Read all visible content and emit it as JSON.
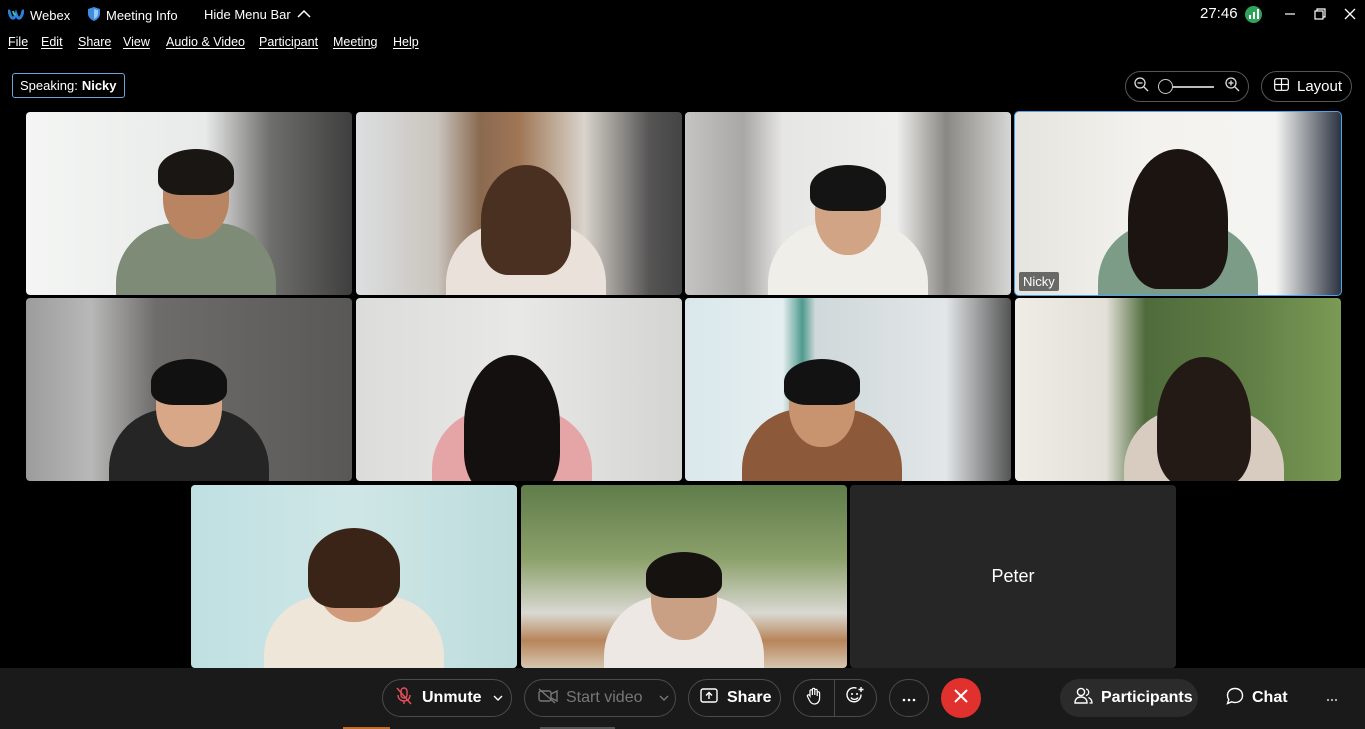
{
  "titlebar": {
    "app_name": "Webex",
    "meeting_info": "Meeting Info",
    "hide_menu": "Hide Menu Bar",
    "time": "27:46"
  },
  "menu": [
    "File",
    "Edit",
    "Share",
    "View",
    "Audio & Video",
    "Participant",
    "Meeting",
    "Help"
  ],
  "speaking": {
    "label": "Speaking:",
    "name": "Nicky"
  },
  "layout_button": "Layout",
  "tiles": [
    {
      "name": "",
      "active": false
    },
    {
      "name": "",
      "active": false
    },
    {
      "name": "",
      "active": false
    },
    {
      "name": "Nicky",
      "active": true
    },
    {
      "name": "",
      "active": false
    },
    {
      "name": "",
      "active": false
    },
    {
      "name": "",
      "active": false
    },
    {
      "name": "",
      "active": false
    },
    {
      "name": "",
      "active": false
    },
    {
      "name": "",
      "active": false
    },
    {
      "name": "Peter",
      "active": false
    }
  ],
  "controls": {
    "unmute": "Unmute",
    "start_video": "Start video",
    "share": "Share",
    "participants": "Participants",
    "chat": "Chat"
  },
  "colors": {
    "end_call": "#e0312f",
    "active_border": "#4ea3f1",
    "signal": "#2fa35a"
  }
}
